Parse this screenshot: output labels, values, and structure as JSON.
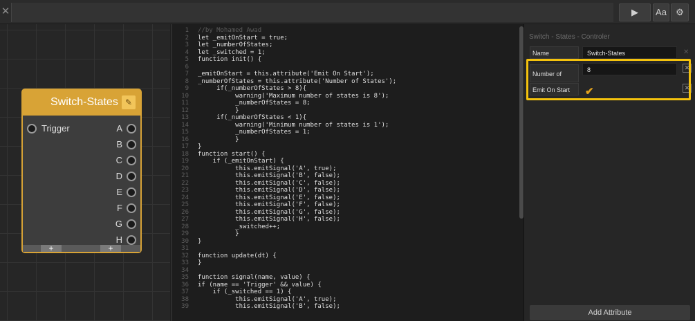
{
  "toolbar": {
    "close_glyph": "✕",
    "play_glyph": "▶",
    "font_label": "Aa",
    "gear_glyph": "⚙"
  },
  "node": {
    "title": "Switch-States",
    "edit_glyph": "✎",
    "input": "Trigger",
    "outputs": [
      "A",
      "B",
      "C",
      "D",
      "E",
      "F",
      "G",
      "H"
    ],
    "plus_glyph": "+"
  },
  "editor": {
    "line_numbers": [
      "1",
      "2",
      "3",
      "4",
      "5",
      "6",
      "7",
      "8",
      "9",
      "10",
      "11",
      "12",
      "13",
      "14",
      "15",
      "16",
      "17",
      "18",
      "19",
      "20",
      "21",
      "22",
      "23",
      "24",
      "25",
      "26",
      "27",
      "28",
      "29",
      "30",
      "31",
      "32",
      "33",
      "34",
      "35",
      "36",
      "37",
      "38",
      "39"
    ],
    "lines": [
      "//by Mohamed Awad",
      "let _emitOnStart = true;",
      "let _numberOfStates;",
      "let _switched = 1;",
      "function init() {",
      "",
      "_emitOnStart = this.attribute('Emit On Start');",
      "_numberOfStates = this.attribute('Number of States');",
      "     if(_numberOfStates > 8){",
      "          warning('Maximum number of states is 8');",
      "          _numberOfStates = 8;",
      "          }",
      "     if(_numberOfStates < 1){",
      "          warning('Minimum number of states is 1');",
      "          _numberOfStates = 1;",
      "          }",
      "}",
      "function start() {",
      "    if (_emitOnStart) {",
      "          this.emitSignal('A', true);",
      "          this.emitSignal('B', false);",
      "          this.emitSignal('C', false);",
      "          this.emitSignal('D', false);",
      "          this.emitSignal('E', false);",
      "          this.emitSignal('F', false);",
      "          this.emitSignal('G', false);",
      "          this.emitSignal('H', false);",
      "          _switched++;",
      "          }",
      "}",
      "",
      "function update(dt) {",
      "}",
      "",
      "function signal(name, value) {",
      "if (name == 'Trigger' && value) {",
      "    if (_switched == 1) {",
      "          this.emitSignal('A', true);",
      "          this.emitSignal('B', false);"
    ]
  },
  "panel": {
    "title": "Switch - States - Controler",
    "rows": [
      {
        "label": "Name",
        "value": "Switch-States",
        "remove": "✕"
      },
      {
        "label": "Number of States",
        "value": "8",
        "remove": "✕"
      },
      {
        "label": "Emit On Start",
        "checked_glyph": "✔",
        "remove": "✕"
      }
    ],
    "add_button": "Add Attribute"
  },
  "colors": {
    "node_accent": "#d8a336",
    "highlight": "#f4c20d",
    "check": "#e2a21d"
  }
}
